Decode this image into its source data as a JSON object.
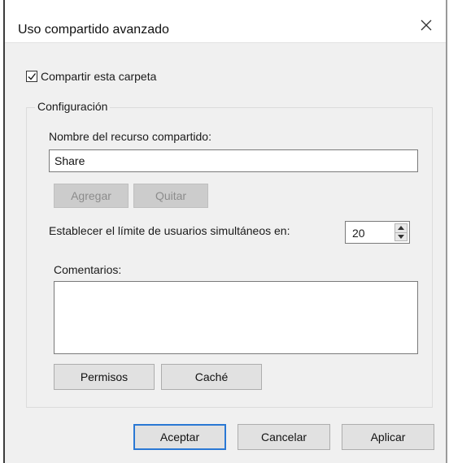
{
  "window": {
    "title": "Uso compartido avanzado",
    "close_glyph": "✕"
  },
  "share_checkbox": {
    "label": "Compartir esta carpeta",
    "checked": true
  },
  "settings": {
    "group_title": "Configuración",
    "share_name_label": "Nombre del recurso compartido:",
    "share_name_value": "Share",
    "add_label": "Agregar",
    "remove_label": "Quitar",
    "user_limit_label": "Establecer el límite de usuarios simultáneos en:",
    "user_limit_value": "20",
    "comments_label": "Comentarios:",
    "comments_value": "",
    "permissions_label": "Permisos",
    "caching_label": "Caché"
  },
  "footer": {
    "ok_label": "Aceptar",
    "cancel_label": "Cancelar",
    "apply_label": "Aplicar"
  },
  "icons": {
    "close": "close-icon",
    "check": "checkmark-icon",
    "spin_up": "spin-up-arrow-icon",
    "spin_down": "spin-down-arrow-icon"
  },
  "colors": {
    "dialog_background": "#f0f0f0",
    "titlebar_background": "#ffffff",
    "default_button_border": "#2a78d4",
    "disabled_button_background": "#cccccc"
  }
}
